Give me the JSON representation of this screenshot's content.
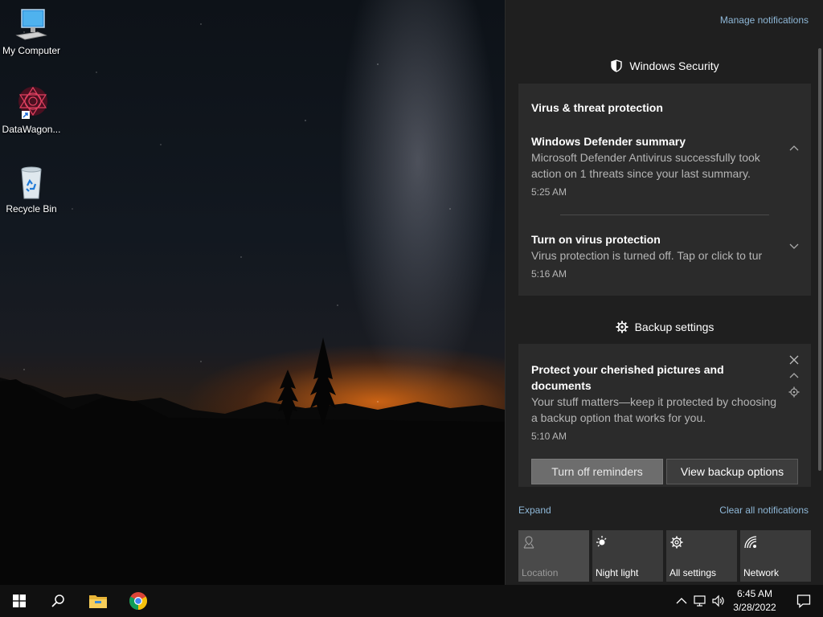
{
  "desktop": {
    "icons": [
      {
        "label": "My Computer",
        "icon": "computer-icon"
      },
      {
        "label": "DataWagon...",
        "icon": "datawagon-app-icon"
      },
      {
        "label": "Recycle Bin",
        "icon": "recycle-bin-icon"
      }
    ]
  },
  "action_center": {
    "manage_label": "Manage notifications",
    "security_group": {
      "title": "Windows Security",
      "icon": "shield-icon",
      "card_title": "Virus & threat protection",
      "notifications": [
        {
          "title": "Windows Defender summary",
          "body": "Microsoft Defender Antivirus successfully took action on 1 threats since your last summary.",
          "time": "5:25 AM"
        },
        {
          "title": "Turn on virus protection",
          "body": "Virus protection is turned off. Tap or click to tur",
          "time": "5:16 AM"
        }
      ]
    },
    "backup_group": {
      "title": "Backup settings",
      "icon": "gear-icon",
      "notification": {
        "title": "Protect your cherished pictures and documents",
        "body": "Your stuff matters—keep it protected by choosing a backup option that works for you.",
        "time": "5:10 AM"
      },
      "buttons": {
        "turn_off": "Turn off reminders",
        "view": "View backup options"
      }
    },
    "expand_label": "Expand",
    "clear_label": "Clear all notifications",
    "quick_actions": [
      {
        "label": "Location",
        "icon": "location-icon",
        "enabled": false
      },
      {
        "label": "Night light",
        "icon": "night-light-icon",
        "enabled": true
      },
      {
        "label": "All settings",
        "icon": "settings-icon",
        "enabled": true
      },
      {
        "label": "Network",
        "icon": "network-icon",
        "enabled": true
      }
    ]
  },
  "taskbar": {
    "clock": {
      "time": "6:45 AM",
      "date": "3/28/2022"
    },
    "pinned": [
      "windows-start-icon",
      "search-icon",
      "file-explorer-icon",
      "chrome-icon"
    ],
    "tray": [
      "chevron-up-icon",
      "network-tray-icon",
      "volume-icon"
    ]
  },
  "colors": {
    "link": "#8fb8d8",
    "panel": "#1f1f1f",
    "card": "#2b2b2b",
    "tile": "#3a3a3a"
  }
}
